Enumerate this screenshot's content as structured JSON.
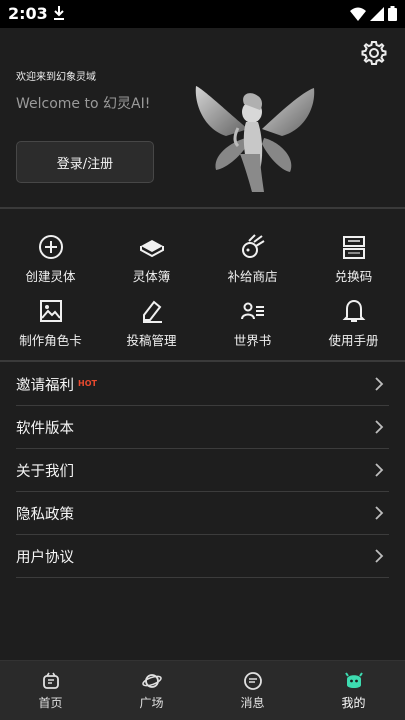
{
  "status_bar": {
    "time": "2:03",
    "icons": [
      "download-icon",
      "wifi-icon",
      "signal-icon",
      "battery-icon"
    ]
  },
  "header": {
    "welcome_small": "欢迎来到幻象灵域",
    "welcome_big": "Welcome to 幻灵AI!",
    "login_label": "登录/注册",
    "settings_icon": "gear-icon"
  },
  "grid": {
    "items": [
      {
        "label": "创建灵体",
        "icon": "plus-circle-icon"
      },
      {
        "label": "灵体簿",
        "icon": "book-stack-icon"
      },
      {
        "label": "补给商店",
        "icon": "comet-icon"
      },
      {
        "label": "兑换码",
        "icon": "redeem-code-icon"
      },
      {
        "label": "制作角色卡",
        "icon": "image-icon"
      },
      {
        "label": "投稿管理",
        "icon": "edit-pen-icon"
      },
      {
        "label": "世界书",
        "icon": "person-list-icon"
      },
      {
        "label": "使用手册",
        "icon": "bell-icon"
      }
    ]
  },
  "menu": {
    "hot_badge": "HOT",
    "items": [
      {
        "label": "邀请福利"
      },
      {
        "label": "软件版本"
      },
      {
        "label": "关于我们"
      },
      {
        "label": "隐私政策"
      },
      {
        "label": "用户协议"
      }
    ]
  },
  "tabbar": {
    "active_color": "#3ddbb0",
    "items": [
      {
        "label": "首页",
        "icon": "home-icon"
      },
      {
        "label": "广场",
        "icon": "planet-icon"
      },
      {
        "label": "消息",
        "icon": "message-icon"
      },
      {
        "label": "我的",
        "icon": "mine-face-icon"
      }
    ],
    "active_index": 3
  }
}
